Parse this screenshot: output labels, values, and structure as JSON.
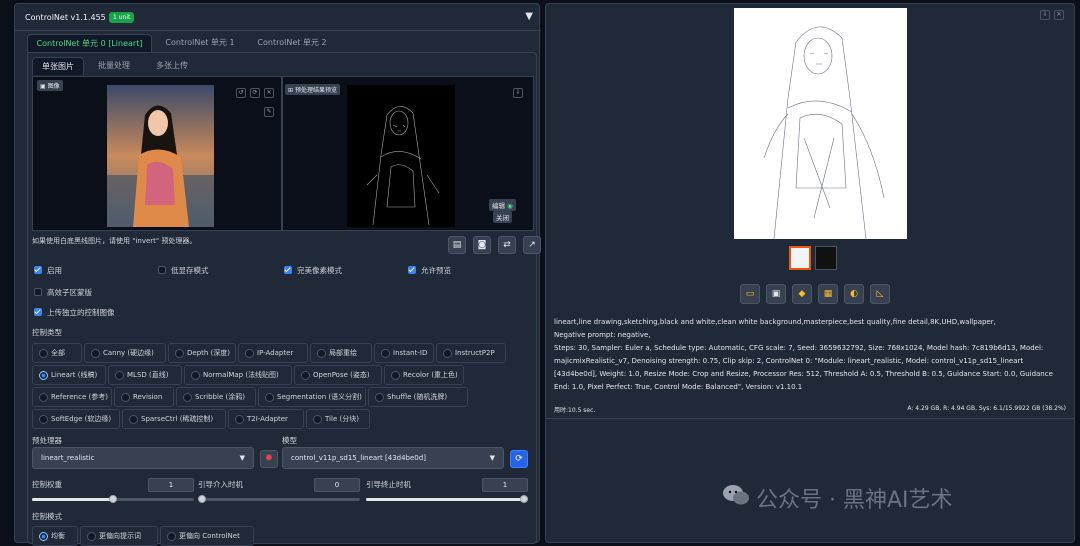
{
  "header": {
    "title": "ControlNet v1.1.455",
    "badge": "1 unit"
  },
  "unit_tabs": [
    "ControlNet 单元 0 [Lineart]",
    "ControlNet 单元 1",
    "ControlNet 单元 2"
  ],
  "image_tabs": [
    "单张图片",
    "批量处理",
    "多张上传"
  ],
  "image_label": "图像",
  "preview_label": "预处理结果预览",
  "edit_btn": "编辑",
  "close_btn": "关闭",
  "invert_hint": "如果使用白底黑线图片，请使用 \"invert\" 预处理器。",
  "checkboxes": {
    "enable": "启用",
    "low_vram": "低显存模式",
    "pixel_perfect": "完美像素模式",
    "allow_preview": "允许预览",
    "effective_region": "高效子区蒙版",
    "upload_independent": "上传独立的控制图像"
  },
  "control_type_label": "控制类型",
  "control_types": [
    "全部",
    "Canny (硬边缘)",
    "Depth (深度)",
    "IP-Adapter",
    "局部重绘",
    "Instant-ID",
    "InstructP2P",
    "Lineart (线稿)",
    "MLSD (直线)",
    "NormalMap (法线贴图)",
    "OpenPose (姿态)",
    "Recolor (重上色)",
    "Reference (参考)",
    "Revision",
    "Scribble (涂鸦)",
    "Segmentation (语义分割)",
    "Shuffle (随机洗牌)",
    "SoftEdge (软边缘)",
    "SparseCtrl (稀疏控制)",
    "T2I-Adapter",
    "Tile (分块)"
  ],
  "preprocessor_label": "预处理器",
  "preprocessor_value": "lineart_realistic",
  "model_label": "模型",
  "model_value": "control_v11p_sd15_lineart [43d4be0d]",
  "weight_label": "控制权重",
  "weight_value": "1",
  "start_label": "引导介入时机",
  "start_value": "0",
  "end_label": "引导终止时机",
  "end_value": "1",
  "mode_label": "控制模式",
  "modes": [
    "均衡",
    "更偏向提示词",
    "更偏向 ControlNet"
  ],
  "output": {
    "prompt": "lineart,line drawing,sketching,black and white,clean white background,masterpiece,best quality,fine detail,8K,UHD,wallpaper,",
    "negative": "Negative prompt: negative,",
    "params": "Steps: 30, Sampler: Euler a, Schedule type: Automatic, CFG scale: 7, Seed: 3659632792, Size: 768x1024, Model hash: 7c819b6d13, Model: majicmixRealistic_v7, Denoising strength: 0.75, Clip skip: 2, ControlNet 0: \"Module: lineart_realistic, Model: control_v11p_sd15_lineart [43d4be0d], Weight: 1.0, Resize Mode: Crop and Resize, Processor Res: 512, Threshold A: 0.5, Threshold B: 0.5, Guidance Start: 0.0, Guidance End: 1.0, Pixel Perfect: True, Control Mode: Balanced\", Version: v1.10.1",
    "time": "用时:10.5 sec.",
    "vram": "A: 4.29 GB, R: 4.94 GB, Sys: 6.1/15.9922 GB (38.2%)"
  },
  "watermark": "公众号 · 黑神AI艺术",
  "colors": {
    "accent": "#3b82f6",
    "active_tab": "#4ade80",
    "badge": "#16a34a",
    "bg": "#0b0f19"
  }
}
